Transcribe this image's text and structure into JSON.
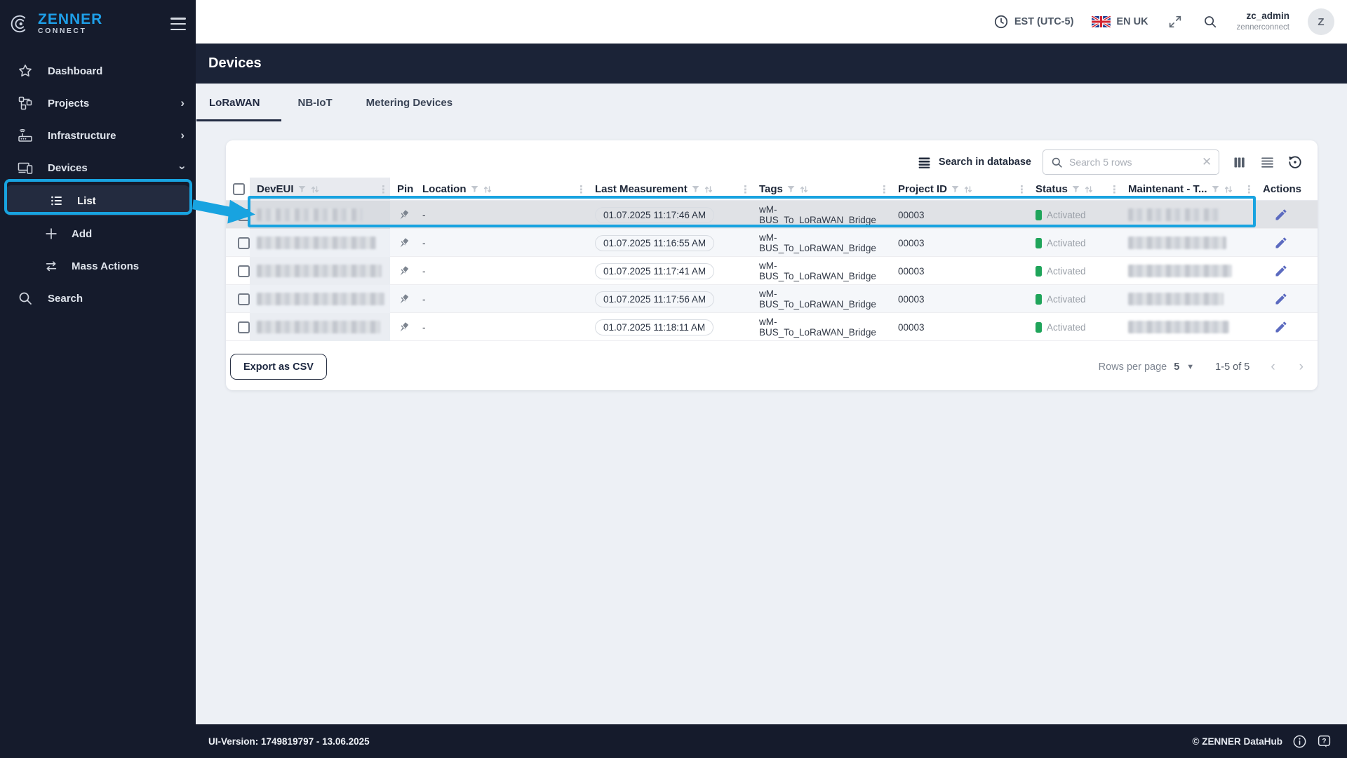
{
  "brand": {
    "title": "ZENNER",
    "subtitle": "CONNECT"
  },
  "sidebar": {
    "dashboard": "Dashboard",
    "projects": "Projects",
    "infrastructure": "Infrastructure",
    "devices": "Devices",
    "list": "List",
    "add": "Add",
    "mass_actions": "Mass Actions",
    "search": "Search"
  },
  "header": {
    "timezone": "EST (UTC-5)",
    "language": "EN UK",
    "user_name": "zc_admin",
    "user_org": "zennerconnect",
    "avatar_letter": "Z"
  },
  "page": {
    "title": "Devices"
  },
  "tabs": {
    "0": "LoRaWAN",
    "1": "NB-IoT",
    "2": "Metering Devices"
  },
  "toolbar": {
    "search_in_database": "Search in database",
    "search_placeholder": "Search 5 rows"
  },
  "table": {
    "columns": [
      {
        "label": "DevEUI"
      },
      {
        "label": "Pin"
      },
      {
        "label": "Location"
      },
      {
        "label": "Last Measurement"
      },
      {
        "label": "Tags"
      },
      {
        "label": "Project ID"
      },
      {
        "label": "Status"
      },
      {
        "label": "Maintenant - T..."
      },
      {
        "label": "Actions"
      }
    ],
    "rows": [
      {
        "location": "-",
        "last_measurement": "01.07.2025 11:17:46 AM",
        "tags": "wM-BUS_To_LoRaWAN_Bridge",
        "project_id": "00003",
        "status": "Activated"
      },
      {
        "location": "-",
        "last_measurement": "01.07.2025 11:16:55 AM",
        "tags": "wM-BUS_To_LoRaWAN_Bridge",
        "project_id": "00003",
        "status": "Activated"
      },
      {
        "location": "-",
        "last_measurement": "01.07.2025 11:17:41 AM",
        "tags": "wM-BUS_To_LoRaWAN_Bridge",
        "project_id": "00003",
        "status": "Activated"
      },
      {
        "location": "-",
        "last_measurement": "01.07.2025 11:17:56 AM",
        "tags": "wM-BUS_To_LoRaWAN_Bridge",
        "project_id": "00003",
        "status": "Activated"
      },
      {
        "location": "-",
        "last_measurement": "01.07.2025 11:18:11 AM",
        "tags": "wM-BUS_To_LoRaWAN_Bridge",
        "project_id": "00003",
        "status": "Activated"
      }
    ]
  },
  "table_footer": {
    "export_button": "Export as CSV",
    "rows_per_page_label": "Rows per page",
    "rows_per_page_value": "5",
    "range_label": "1-5 of 5"
  },
  "footer": {
    "ui_version": "UI-Version: 1749819797 - 13.06.2025",
    "copyright": "© ZENNER DataHub"
  },
  "colors": {
    "accent_blue": "#18a3e0",
    "brand_blue": "#1e9fe8",
    "navy": "#151b2c",
    "titlebar_navy": "#1b2337",
    "status_green": "#1fa45a",
    "edit_purple": "#5c6bc0"
  }
}
